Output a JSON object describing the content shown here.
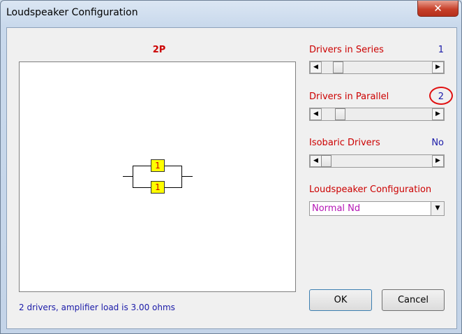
{
  "window": {
    "title": "Loudspeaker Configuration",
    "close_glyph": "✕"
  },
  "diagram": {
    "config_code": "2P",
    "drivers": [
      {
        "label": "1"
      },
      {
        "label": "1"
      }
    ]
  },
  "status_text": "2 drivers, amplifier load is 3.00 ohms",
  "controls": {
    "series": {
      "label": "Drivers in Series",
      "value": "1"
    },
    "parallel": {
      "label": "Drivers in Parallel",
      "value": "2"
    },
    "isobaric": {
      "label": "Isobaric Drivers",
      "value": "No"
    },
    "config": {
      "label": "Loudspeaker Configuration",
      "selected": "Normal Nd"
    }
  },
  "buttons": {
    "ok": "OK",
    "cancel": "Cancel"
  },
  "icons": {
    "left_arrow": "arrow-left-icon",
    "right_arrow": "arrow-right-icon",
    "dropdown": "chevron-down-icon",
    "close": "close-icon"
  },
  "colors": {
    "label_red": "#cc0000",
    "value_blue": "#1a1aa8",
    "dropdown_text": "#b517b5",
    "driver_fill": "#ffff00",
    "annotation": "#e01010"
  }
}
